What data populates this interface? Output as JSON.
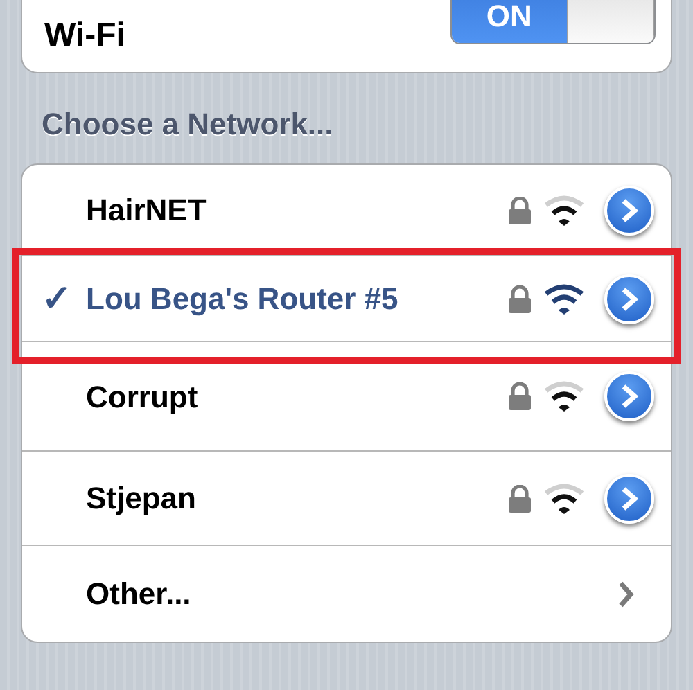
{
  "wifi": {
    "label": "Wi-Fi",
    "on": true,
    "toggle_text": "ON"
  },
  "section_header": "Choose a Network...",
  "networks": [
    {
      "kind": "network",
      "name": "HairNET",
      "selected": false,
      "locked": true,
      "highlighted": false
    },
    {
      "kind": "network",
      "name": "Lou Bega's Router #5",
      "selected": true,
      "check": "✓",
      "locked": true,
      "highlighted": true
    },
    {
      "kind": "network",
      "name": "Corrupt",
      "selected": false,
      "locked": true,
      "highlighted": false
    },
    {
      "kind": "network",
      "name": "Stjepan",
      "selected": false,
      "locked": true,
      "highlighted": false
    },
    {
      "kind": "other",
      "name": "Other..."
    }
  ]
}
